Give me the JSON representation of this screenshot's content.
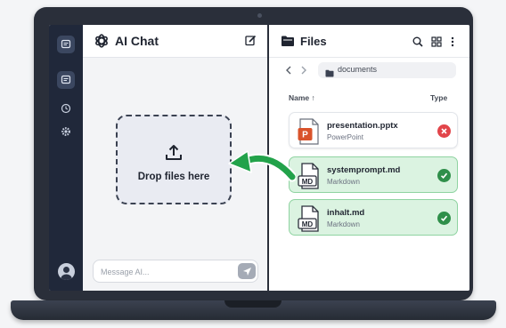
{
  "chat": {
    "title": "AI Chat",
    "drop_label": "Drop files here",
    "message_placeholder": "Message AI..."
  },
  "files": {
    "title": "Files",
    "path": "documents",
    "columns": {
      "name": "Name ↑",
      "type": "Type"
    },
    "items": [
      {
        "name": "presentation.pptx",
        "type": "PowerPoint",
        "icon_text": "P",
        "status": "error"
      },
      {
        "name": "systemprompt.md",
        "type": "Markdown",
        "icon_text": "MD",
        "status": "done"
      },
      {
        "name": "inhalt.md",
        "type": "Markdown",
        "icon_text": "MD",
        "status": "done"
      }
    ]
  },
  "colors": {
    "sidebar": "#20283a",
    "success": "#2f8f4a",
    "error": "#e2454a",
    "success_bg": "#dbf3e1",
    "arrow": "#22a24a",
    "powerpoint": "#d9532b"
  },
  "icons": {
    "rail": [
      "chat-icon",
      "chat-icon",
      "history-icon",
      "settings-icon"
    ],
    "chat_header": [
      "openai-logo-icon",
      "edit-icon"
    ],
    "files_header": [
      "folder-icon",
      "search-icon",
      "grid-icon",
      "more-icon"
    ]
  }
}
